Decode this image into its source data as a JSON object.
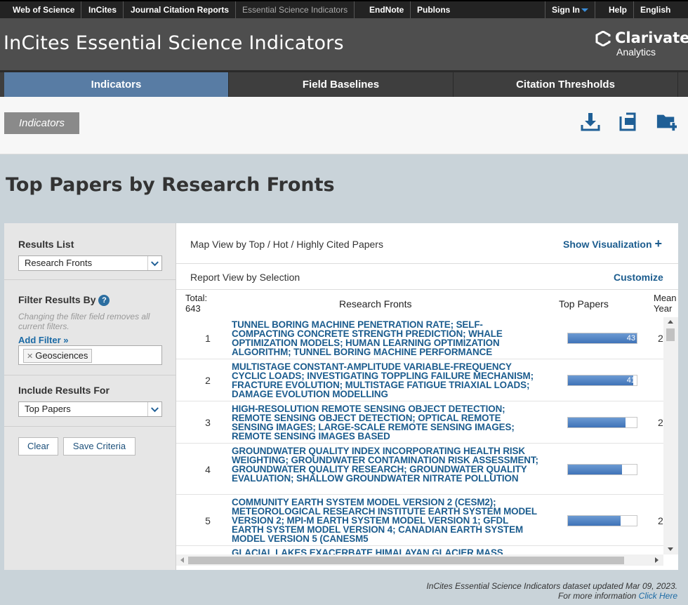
{
  "topnav": {
    "left": [
      "Web of Science",
      "InCites",
      "Journal Citation Reports",
      "Essential Science Indicators",
      "EndNote",
      "Publons"
    ],
    "right": [
      "Sign In",
      "Help",
      "English"
    ]
  },
  "header": {
    "app_title": "InCites Essential Science Indicators",
    "logo_name": "Clarivate",
    "logo_sub": "Analytics"
  },
  "tabs": [
    "Indicators",
    "Field Baselines",
    "Citation Thresholds"
  ],
  "toolbar": {
    "breadcrumb": "Indicators",
    "icons": [
      "download-icon",
      "print-icon",
      "folder-add-icon"
    ]
  },
  "page_title": "Top Papers by Research Fronts",
  "left_panel": {
    "results_list_label": "Results List",
    "results_list_value": "Research Fronts",
    "filter_label": "Filter Results By",
    "filter_hint": "Changing the filter field removes all current filters.",
    "add_filter": "Add Filter »",
    "filter_chip": "Geosciences",
    "include_label": "Include Results For",
    "include_value": "Top Papers",
    "clear_button": "Clear",
    "save_button": "Save Criteria"
  },
  "right_panel": {
    "map_view_prefix": "Map View by",
    "map_view_options": "Top / Hot / Highly Cited Papers",
    "show_visualization": "Show Visualization",
    "report_view": "Report View by Selection",
    "customize": "Customize",
    "total_label": "Total:",
    "total_value": "643",
    "col_fronts": "Research Fronts",
    "col_top_papers": "Top Papers",
    "col_mean_line1": "Mean",
    "col_mean_line2": "Year"
  },
  "table": {
    "max_value": 43,
    "rows": [
      {
        "num": "1",
        "front": "TUNNEL BORING MACHINE PENETRATION RATE; SELF-COMPACTING CONCRETE STRENGTH PREDICTION; WHALE OPTIMIZATION MODELS; HUMAN LEARNING OPTIMIZATION ALGORITHM; TUNNEL BORING MACHINE PERFORMANCE",
        "top_papers": 43,
        "mean": "2"
      },
      {
        "num": "2",
        "front": "MULTISTAGE CONSTANT-AMPLITUDE VARIABLE-FREQUENCY CYCLIC LOADS; INVESTIGATING TOPPLING FAILURE MECHANISM; FRACTURE EVOLUTION; MULTISTAGE FATIGUE TRIAXIAL LOADS; DAMAGE EVOLUTION MODELLING",
        "top_papers": 41,
        "mean": ""
      },
      {
        "num": "3",
        "front": "HIGH-RESOLUTION REMOTE SENSING OBJECT DETECTION; REMOTE SENSING OBJECT DETECTION; OPTICAL REMOTE SENSING IMAGES; LARGE-SCALE REMOTE SENSING IMAGES; REMOTE SENSING IMAGES BASED",
        "top_papers": 36,
        "mean": "2"
      },
      {
        "num": "4",
        "front": "GROUNDWATER QUALITY INDEX INCORPORATING HEALTH RISK WEIGHTING; GROUNDWATER CONTAMINATION RISK ASSESSMENT; GROUNDWATER QUALITY RESEARCH; GROUNDWATER QUALITY EVALUATION; SHALLOW GROUNDWATER NITRATE POLLUTION",
        "top_papers": 34,
        "mean": ""
      },
      {
        "num": "5",
        "front": "COMMUNITY EARTH SYSTEM MODEL VERSION 2 (CESM2); METEOROLOGICAL RESEARCH INSTITUTE EARTH SYSTEM MODEL VERSION 2; MPI-M EARTH SYSTEM MODEL VERSION 1; GFDL EARTH SYSTEM MODEL VERSION 4; CANADIAN EARTH SYSTEM MODEL VERSION 5 (CANESM5",
        "top_papers": 33,
        "mean": "2"
      },
      {
        "num": "",
        "front": "GLACIAL LAKES EXACERBATE HIMALAYAN GLACIER MASS",
        "top_papers": null,
        "mean": ""
      }
    ]
  },
  "footer": {
    "line1": "InCites Essential Science Indicators dataset updated Mar 09, 2023.",
    "line2_prefix": "For more information",
    "line2_link": "Click Here"
  },
  "colors": {
    "tab_active": "#587ca4",
    "link": "#1b5c8e",
    "bar_fill": "#4a7fc1"
  }
}
